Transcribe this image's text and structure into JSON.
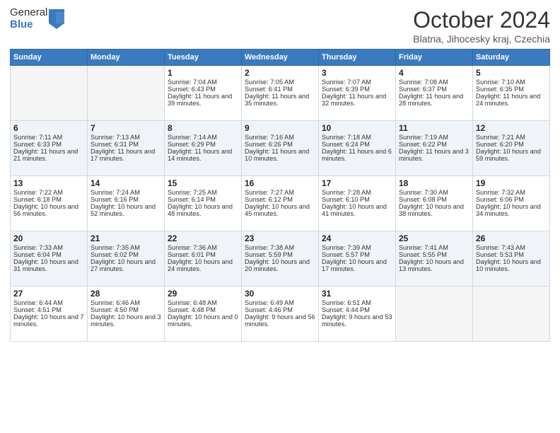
{
  "logo": {
    "general": "General",
    "blue": "Blue"
  },
  "header": {
    "month": "October 2024",
    "location": "Blatna, Jihocesky kraj, Czechia"
  },
  "weekdays": [
    "Sunday",
    "Monday",
    "Tuesday",
    "Wednesday",
    "Thursday",
    "Friday",
    "Saturday"
  ],
  "weeks": [
    [
      {
        "day": "",
        "sunrise": "",
        "sunset": "",
        "daylight": ""
      },
      {
        "day": "",
        "sunrise": "",
        "sunset": "",
        "daylight": ""
      },
      {
        "day": "1",
        "sunrise": "Sunrise: 7:04 AM",
        "sunset": "Sunset: 6:43 PM",
        "daylight": "Daylight: 11 hours and 39 minutes."
      },
      {
        "day": "2",
        "sunrise": "Sunrise: 7:05 AM",
        "sunset": "Sunset: 6:41 PM",
        "daylight": "Daylight: 11 hours and 35 minutes."
      },
      {
        "day": "3",
        "sunrise": "Sunrise: 7:07 AM",
        "sunset": "Sunset: 6:39 PM",
        "daylight": "Daylight: 11 hours and 32 minutes."
      },
      {
        "day": "4",
        "sunrise": "Sunrise: 7:08 AM",
        "sunset": "Sunset: 6:37 PM",
        "daylight": "Daylight: 11 hours and 28 minutes."
      },
      {
        "day": "5",
        "sunrise": "Sunrise: 7:10 AM",
        "sunset": "Sunset: 6:35 PM",
        "daylight": "Daylight: 11 hours and 24 minutes."
      }
    ],
    [
      {
        "day": "6",
        "sunrise": "Sunrise: 7:11 AM",
        "sunset": "Sunset: 6:33 PM",
        "daylight": "Daylight: 11 hours and 21 minutes."
      },
      {
        "day": "7",
        "sunrise": "Sunrise: 7:13 AM",
        "sunset": "Sunset: 6:31 PM",
        "daylight": "Daylight: 11 hours and 17 minutes."
      },
      {
        "day": "8",
        "sunrise": "Sunrise: 7:14 AM",
        "sunset": "Sunset: 6:29 PM",
        "daylight": "Daylight: 11 hours and 14 minutes."
      },
      {
        "day": "9",
        "sunrise": "Sunrise: 7:16 AM",
        "sunset": "Sunset: 6:26 PM",
        "daylight": "Daylight: 11 hours and 10 minutes."
      },
      {
        "day": "10",
        "sunrise": "Sunrise: 7:18 AM",
        "sunset": "Sunset: 6:24 PM",
        "daylight": "Daylight: 11 hours and 6 minutes."
      },
      {
        "day": "11",
        "sunrise": "Sunrise: 7:19 AM",
        "sunset": "Sunset: 6:22 PM",
        "daylight": "Daylight: 11 hours and 3 minutes."
      },
      {
        "day": "12",
        "sunrise": "Sunrise: 7:21 AM",
        "sunset": "Sunset: 6:20 PM",
        "daylight": "Daylight: 10 hours and 59 minutes."
      }
    ],
    [
      {
        "day": "13",
        "sunrise": "Sunrise: 7:22 AM",
        "sunset": "Sunset: 6:18 PM",
        "daylight": "Daylight: 10 hours and 56 minutes."
      },
      {
        "day": "14",
        "sunrise": "Sunrise: 7:24 AM",
        "sunset": "Sunset: 6:16 PM",
        "daylight": "Daylight: 10 hours and 52 minutes."
      },
      {
        "day": "15",
        "sunrise": "Sunrise: 7:25 AM",
        "sunset": "Sunset: 6:14 PM",
        "daylight": "Daylight: 10 hours and 48 minutes."
      },
      {
        "day": "16",
        "sunrise": "Sunrise: 7:27 AM",
        "sunset": "Sunset: 6:12 PM",
        "daylight": "Daylight: 10 hours and 45 minutes."
      },
      {
        "day": "17",
        "sunrise": "Sunrise: 7:28 AM",
        "sunset": "Sunset: 6:10 PM",
        "daylight": "Daylight: 10 hours and 41 minutes."
      },
      {
        "day": "18",
        "sunrise": "Sunrise: 7:30 AM",
        "sunset": "Sunset: 6:08 PM",
        "daylight": "Daylight: 10 hours and 38 minutes."
      },
      {
        "day": "19",
        "sunrise": "Sunrise: 7:32 AM",
        "sunset": "Sunset: 6:06 PM",
        "daylight": "Daylight: 10 hours and 34 minutes."
      }
    ],
    [
      {
        "day": "20",
        "sunrise": "Sunrise: 7:33 AM",
        "sunset": "Sunset: 6:04 PM",
        "daylight": "Daylight: 10 hours and 31 minutes."
      },
      {
        "day": "21",
        "sunrise": "Sunrise: 7:35 AM",
        "sunset": "Sunset: 6:02 PM",
        "daylight": "Daylight: 10 hours and 27 minutes."
      },
      {
        "day": "22",
        "sunrise": "Sunrise: 7:36 AM",
        "sunset": "Sunset: 6:01 PM",
        "daylight": "Daylight: 10 hours and 24 minutes."
      },
      {
        "day": "23",
        "sunrise": "Sunrise: 7:38 AM",
        "sunset": "Sunset: 5:59 PM",
        "daylight": "Daylight: 10 hours and 20 minutes."
      },
      {
        "day": "24",
        "sunrise": "Sunrise: 7:39 AM",
        "sunset": "Sunset: 5:57 PM",
        "daylight": "Daylight: 10 hours and 17 minutes."
      },
      {
        "day": "25",
        "sunrise": "Sunrise: 7:41 AM",
        "sunset": "Sunset: 5:55 PM",
        "daylight": "Daylight: 10 hours and 13 minutes."
      },
      {
        "day": "26",
        "sunrise": "Sunrise: 7:43 AM",
        "sunset": "Sunset: 5:53 PM",
        "daylight": "Daylight: 10 hours and 10 minutes."
      }
    ],
    [
      {
        "day": "27",
        "sunrise": "Sunrise: 6:44 AM",
        "sunset": "Sunset: 4:51 PM",
        "daylight": "Daylight: 10 hours and 7 minutes."
      },
      {
        "day": "28",
        "sunrise": "Sunrise: 6:46 AM",
        "sunset": "Sunset: 4:50 PM",
        "daylight": "Daylight: 10 hours and 3 minutes."
      },
      {
        "day": "29",
        "sunrise": "Sunrise: 6:48 AM",
        "sunset": "Sunset: 4:48 PM",
        "daylight": "Daylight: 10 hours and 0 minutes."
      },
      {
        "day": "30",
        "sunrise": "Sunrise: 6:49 AM",
        "sunset": "Sunset: 4:46 PM",
        "daylight": "Daylight: 9 hours and 56 minutes."
      },
      {
        "day": "31",
        "sunrise": "Sunrise: 6:51 AM",
        "sunset": "Sunset: 4:44 PM",
        "daylight": "Daylight: 9 hours and 53 minutes."
      },
      {
        "day": "",
        "sunrise": "",
        "sunset": "",
        "daylight": ""
      },
      {
        "day": "",
        "sunrise": "",
        "sunset": "",
        "daylight": ""
      }
    ]
  ]
}
